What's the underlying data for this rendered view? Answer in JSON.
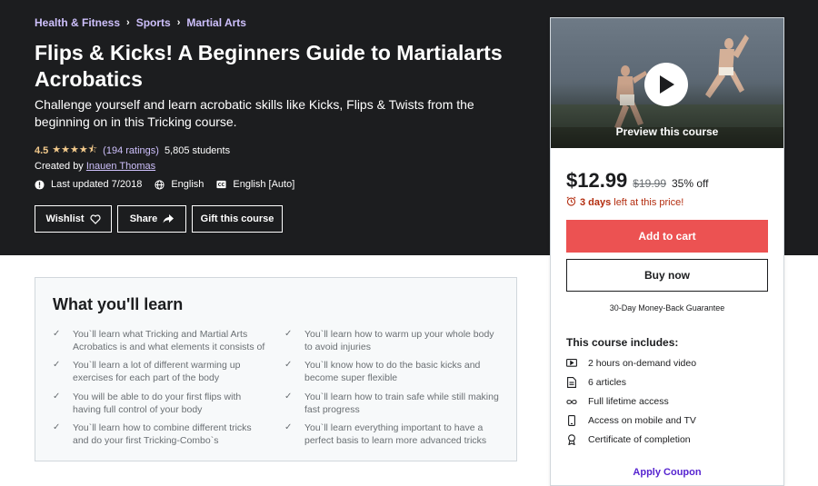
{
  "breadcrumb": [
    "Health & Fitness",
    "Sports",
    "Martial Arts"
  ],
  "course": {
    "title": "Flips & Kicks! A Beginners Guide to Martialarts Acrobatics",
    "subtitle": "Challenge yourself and learn acrobatic skills like Kicks, Flips & Twists from the beginning on in this Tricking course.",
    "rating": "4.5",
    "rating_value": 4.5,
    "rating_count": "(194 ratings)",
    "students": "5,805 students",
    "created_by_label": "Created by",
    "instructor": "Inauen Thomas",
    "last_updated": "Last updated 7/2018",
    "language": "English",
    "captions": "English [Auto]"
  },
  "actions": {
    "wishlist": "Wishlist",
    "share": "Share",
    "gift": "Gift this course"
  },
  "learn": {
    "title": "What you'll learn",
    "items": [
      "You`ll learn what Tricking and Martial Arts Acrobatics is and what elements it consists of",
      "You`ll learn how to warm up your whole body to avoid injuries",
      "You`ll learn a lot of different warming up exercises for each part of the body",
      "You`ll know how to do the basic kicks and become super flexible",
      "You will be able to do your first flips with having full control of your body",
      "You`ll learn how to train safe while still making fast progress",
      "You`ll learn how to combine different tricks and do your first Tricking-Combo`s",
      "You`ll learn everything important to have a perfect basis to learn more advanced tricks"
    ]
  },
  "sidebar": {
    "preview_label": "Preview this course",
    "price": "$12.99",
    "original_price": "$19.99",
    "discount": "35% off",
    "timer_prefix": "",
    "timer_bold": "3 days",
    "timer_suffix": "left at this price!",
    "add_to_cart": "Add to cart",
    "buy_now": "Buy now",
    "guarantee": "30-Day Money-Back Guarantee",
    "includes_title": "This course includes:",
    "includes": [
      {
        "icon": "video-icon",
        "label": "2 hours on-demand video"
      },
      {
        "icon": "article-icon",
        "label": "6 articles"
      },
      {
        "icon": "infinity-icon",
        "label": "Full lifetime access"
      },
      {
        "icon": "mobile-icon",
        "label": "Access on mobile and TV"
      },
      {
        "icon": "certificate-icon",
        "label": "Certificate of completion"
      }
    ],
    "coupon": "Apply Coupon"
  },
  "colors": {
    "hero_bg": "#1c1d1f",
    "link_purple": "#cec0fc",
    "star_gold": "#f3ca8c",
    "cart_red": "#ec5252",
    "timer_red": "#b32d0f",
    "coupon_purple": "#5624d0"
  }
}
